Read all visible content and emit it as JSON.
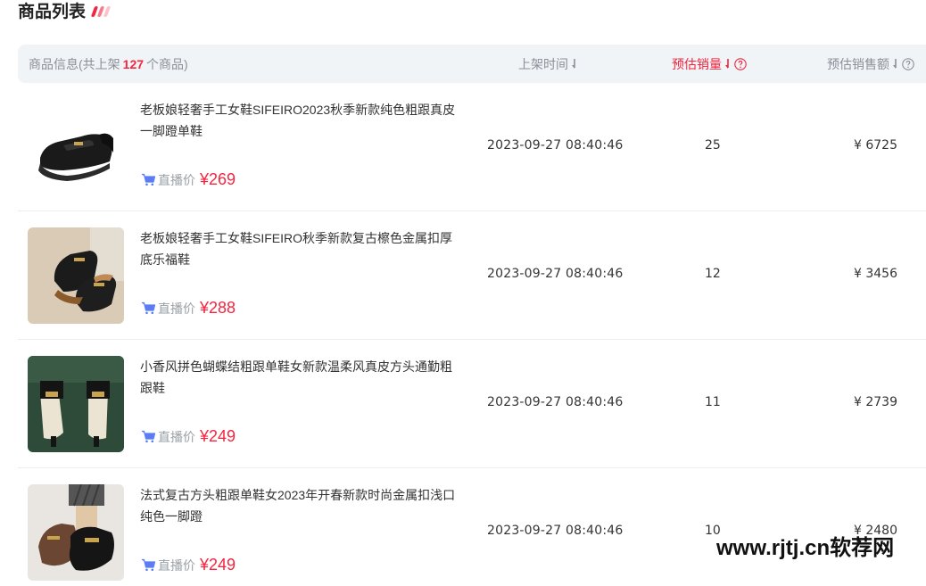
{
  "section": {
    "title": "商品列表",
    "deco_colors": [
      "#f5243f",
      "#f77b8c",
      "#fbc2ca"
    ]
  },
  "table": {
    "header": {
      "info_prefix": "商品信息(共上架",
      "info_count": "127",
      "info_suffix": "个商品)",
      "time": "上架时间",
      "sales": "预估销量",
      "amount": "预估销售额"
    },
    "rows": [
      {
        "name": "老板娘轻奢手工女鞋SIFEIRO2023秋季新款纯色粗跟真皮一脚蹬单鞋",
        "price_label": "直播价",
        "price": "¥269",
        "time": "2023-09-27 08:40:46",
        "sales": "25",
        "amount": "¥ 6725",
        "thumb_bg": "#ffffff"
      },
      {
        "name": "老板娘轻奢手工女鞋SIFEIRO秋季新款复古檫色金属扣厚底乐福鞋",
        "price_label": "直播价",
        "price": "¥288",
        "time": "2023-09-27 08:40:46",
        "sales": "12",
        "amount": "¥ 3456",
        "thumb_bg": "#d6c8b2"
      },
      {
        "name": "小香风拼色蝴蝶结粗跟单鞋女新款温柔风真皮方头通勤粗跟鞋",
        "price_label": "直播价",
        "price": "¥249",
        "time": "2023-09-27 08:40:46",
        "sales": "11",
        "amount": "¥ 2739",
        "thumb_bg": "#2f4a3a"
      },
      {
        "name": "法式复古方头粗跟单鞋女2023年开春新款时尚金属扣浅口纯色一脚蹬",
        "price_label": "直播价",
        "price": "¥249",
        "time": "2023-09-27 08:40:46",
        "sales": "10",
        "amount": "¥ 2480",
        "thumb_bg": "#e8e4df"
      }
    ]
  },
  "watermark": "www.rjtj.cn软荐网",
  "colors": {
    "accent": "#f5243f",
    "header_bg": "#f0f4f6",
    "muted": "#8a9099",
    "cart": "#5b7cf5"
  }
}
